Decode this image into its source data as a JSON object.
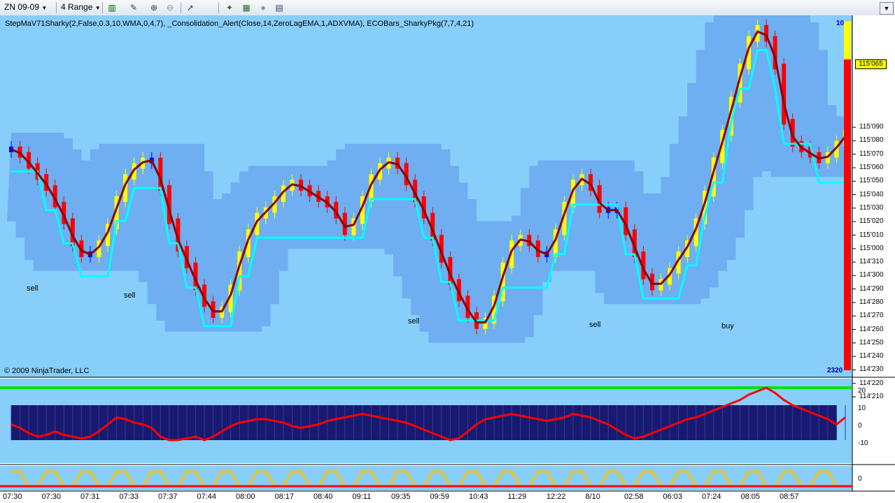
{
  "toolbar": {
    "instrument": "ZN 09-09",
    "interval": "4 Range",
    "icons": [
      "bar-type-icon",
      "draw-tool-icon",
      "zoom-in-icon",
      "zoom-out-icon",
      "cursor-icon",
      "strategy-icon",
      "indicator-icon",
      "sphere-icon",
      "properties-icon"
    ]
  },
  "chart_data": [
    {
      "type": "candlestick",
      "title": "StepMaV71Sharky(2,False,0.3,10,WMA,0,4,7), _Consolidation_Alert(Close,14,ZeroLagEMA,1,ADXVMA), ECOBars_SharkyPkg(7,7,4,21)",
      "copyright": "© 2009 NinjaTrader, LLC",
      "corner_top": "10",
      "corner_bottom": "2320",
      "current_price": "115'065",
      "price_ticks": [
        "115'090",
        "115'080",
        "115'070",
        "115'060",
        "115'050",
        "115'040",
        "115'030",
        "115'020",
        "115'010",
        "115'000",
        "114'310",
        "114'300",
        "114'290",
        "114'280",
        "114'270",
        "114'260",
        "114'250",
        "114'240",
        "114'230",
        "114'220",
        "114'210"
      ],
      "ylim": [
        114.64,
        115.29
      ],
      "x_labels": [
        "07:30",
        "07:30",
        "07:31",
        "07:33",
        "07:37",
        "07:44",
        "08:00",
        "08:17",
        "08:40",
        "09:11",
        "09:35",
        "09:59",
        "10:43",
        "11:29",
        "12:22",
        "8/10",
        "02:58",
        "06:03",
        "07:24",
        "08:05",
        "08:57"
      ],
      "annotations": [
        "sell",
        "sell",
        "sell",
        "sell",
        "buy"
      ],
      "colors": {
        "up": "#ffff00",
        "down": "#ff0000",
        "neutral": "#0000ff",
        "wma": "#8b0000",
        "step_up": "#00ff00",
        "step_down": "#ff00ff",
        "step_flat": "#00ffff",
        "band": "#6aa8ee",
        "background": "#87cefa"
      },
      "series": [
        {
          "name": "close",
          "values": [
            115.05,
            115.04,
            115.02,
            115.0,
            114.98,
            114.95,
            114.92,
            114.88,
            114.86,
            114.86,
            114.88,
            114.91,
            114.96,
            115.0,
            115.02,
            115.03,
            115.03,
            114.98,
            114.92,
            114.87,
            114.84,
            114.8,
            114.77,
            114.75,
            114.76,
            114.8,
            114.86,
            114.9,
            114.93,
            114.94,
            114.96,
            114.98,
            114.99,
            114.98,
            114.97,
            114.96,
            114.95,
            114.93,
            114.9,
            114.92,
            114.96,
            115.0,
            115.02,
            115.03,
            115.02,
            114.99,
            114.96,
            114.93,
            114.89,
            114.85,
            114.81,
            114.78,
            114.75,
            114.73,
            114.74,
            114.78,
            114.84,
            114.88,
            114.89,
            114.88,
            114.86,
            114.86,
            114.9,
            114.95,
            114.99,
            115.0,
            114.98,
            114.94,
            114.94,
            114.94,
            114.9,
            114.86,
            114.82,
            114.8,
            114.81,
            114.83,
            114.86,
            114.88,
            114.92,
            114.97,
            115.03,
            115.08,
            115.14,
            115.2,
            115.25,
            115.27,
            115.25,
            115.2,
            115.1,
            115.06,
            115.05,
            115.04,
            115.03,
            115.04,
            115.06,
            115.08
          ]
        },
        {
          "name": "indicator",
          "values": [
            -1,
            -3,
            -6,
            -8,
            -7,
            -5,
            -7,
            -8,
            -9,
            -8,
            -5,
            -1,
            3,
            2,
            0,
            -1,
            -3,
            -8,
            -10,
            -10,
            -9,
            -8,
            -10,
            -8,
            -5,
            -2,
            0,
            1,
            2,
            2,
            1,
            0,
            -2,
            -3,
            -2,
            -1,
            1,
            2,
            3,
            4,
            5,
            4,
            3,
            2,
            1,
            0,
            -2,
            -4,
            -6,
            -8,
            -10,
            -9,
            -5,
            -1,
            2,
            3,
            4,
            5,
            4,
            3,
            2,
            1,
            2,
            3,
            5,
            4,
            3,
            1,
            -1,
            -4,
            -7,
            -9,
            -8,
            -6,
            -4,
            -2,
            0,
            2,
            3,
            5,
            7,
            9,
            11,
            13,
            16,
            18,
            20,
            17,
            13,
            10,
            8,
            6,
            4,
            2,
            -1,
            3
          ]
        }
      ]
    }
  ]
}
